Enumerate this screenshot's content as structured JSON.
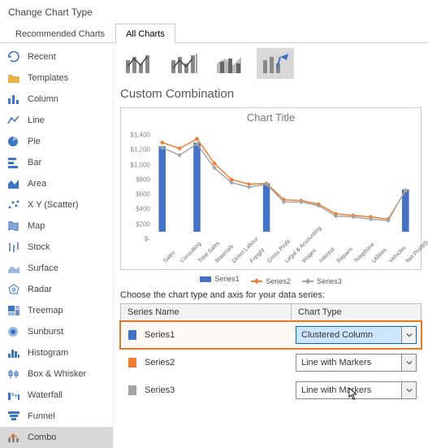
{
  "title": "Change Chart Type",
  "tabs": {
    "rec": "Recommended Charts",
    "all": "All Charts"
  },
  "sidebar": [
    {
      "label": "Recent",
      "selected": false
    },
    {
      "label": "Templates",
      "selected": false
    },
    {
      "label": "Column",
      "selected": false
    },
    {
      "label": "Line",
      "selected": false
    },
    {
      "label": "Pie",
      "selected": false
    },
    {
      "label": "Bar",
      "selected": false
    },
    {
      "label": "Area",
      "selected": false
    },
    {
      "label": "X Y (Scatter)",
      "selected": false
    },
    {
      "label": "Map",
      "selected": false
    },
    {
      "label": "Stock",
      "selected": false
    },
    {
      "label": "Surface",
      "selected": false
    },
    {
      "label": "Radar",
      "selected": false
    },
    {
      "label": "Treemap",
      "selected": false
    },
    {
      "label": "Sunburst",
      "selected": false
    },
    {
      "label": "Histogram",
      "selected": false
    },
    {
      "label": "Box & Whisker",
      "selected": false
    },
    {
      "label": "Waterfall",
      "selected": false
    },
    {
      "label": "Funnel",
      "selected": false
    },
    {
      "label": "Combo",
      "selected": true
    }
  ],
  "subtitle": "Custom Combination",
  "chartTitle": "Chart Title",
  "yticks": [
    "$1,400",
    "$1,200",
    "$1,000",
    "$800",
    "$600",
    "$400",
    "$200",
    "$-"
  ],
  "categories": [
    "Sales",
    "Consulting",
    "Total Sales",
    "Materials",
    "Direct Labour",
    "Freight",
    "Gross Profit",
    "Legal & Accounting",
    "Wages",
    "Interest",
    "Repairs",
    "Telephone",
    "Utilities",
    "Vehicles",
    "Net Profit/(Loss)"
  ],
  "legend": [
    "Series1",
    "Series2",
    "Series3"
  ],
  "instruction": "Choose the chart type and axis for your data series:",
  "gridHeaders": {
    "name": "Series Name",
    "type": "Chart Type"
  },
  "series": [
    {
      "name": "Series1",
      "type": "Clustered Column",
      "color": "#4472C4",
      "highlight": true,
      "open": true
    },
    {
      "name": "Series2",
      "type": "Line with Markers",
      "color": "#ED7D31",
      "highlight": false,
      "open": false
    },
    {
      "name": "Series3",
      "type": "Line with Markers",
      "color": "#A5A5A5",
      "highlight": false,
      "open": false
    }
  ],
  "chart_data": {
    "type": "combo",
    "title": "Chart Title",
    "ylabel": "",
    "xlabel": "",
    "ylim": [
      0,
      1400
    ],
    "categories": [
      "Sales",
      "Consulting",
      "Total Sales",
      "Materials",
      "Direct Labour",
      "Freight",
      "Gross Profit",
      "Legal & Accounting",
      "Wages",
      "Interest",
      "Repairs",
      "Telephone",
      "Utilities",
      "Vehicles",
      "Net Profit/(Loss)"
    ],
    "series": [
      {
        "name": "Series1",
        "type": "bar",
        "color": "#4472C4",
        "values": [
          1150,
          null,
          1200,
          null,
          null,
          null,
          650,
          null,
          null,
          null,
          null,
          null,
          null,
          null,
          570
        ]
      },
      {
        "name": "Series2",
        "type": "line",
        "color": "#ED7D31",
        "values": [
          1200,
          1120,
          1250,
          920,
          700,
          640,
          650,
          430,
          420,
          370,
          240,
          220,
          200,
          170,
          550
        ]
      },
      {
        "name": "Series3",
        "type": "line",
        "color": "#A5A5A5",
        "values": [
          1130,
          1030,
          1180,
          860,
          660,
          600,
          640,
          400,
          400,
          350,
          210,
          200,
          170,
          150,
          560
        ]
      }
    ]
  },
  "colors": {
    "accent": "#4472C4",
    "orange": "#ED7D31",
    "gray": "#A5A5A5",
    "highlight": "#E07B2E",
    "select": "#cde6ff"
  }
}
